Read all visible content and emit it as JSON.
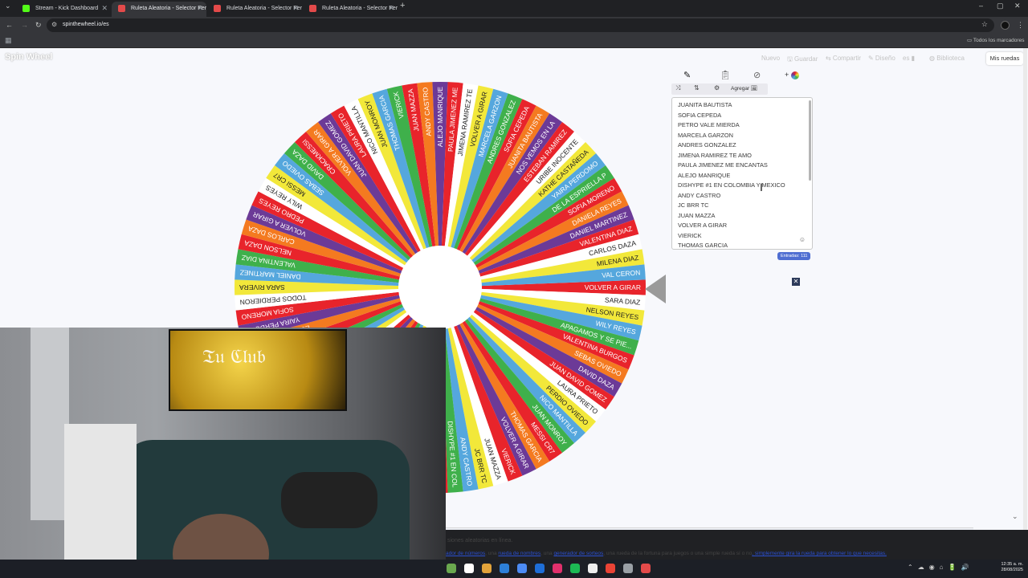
{
  "browser": {
    "tabs": [
      {
        "title": "Stream - Kick Dashboard",
        "favicon_color": "#53fc18",
        "active": false
      },
      {
        "title": "Ruleta Aleatoria - Selector Pers",
        "favicon_color": "#e34a4a",
        "active": true
      },
      {
        "title": "Ruleta Aleatoria - Selector Pers",
        "favicon_color": "#e34a4a",
        "active": false
      },
      {
        "title": "Ruleta Aleatoria - Selector Pers",
        "favicon_color": "#e34a4a",
        "active": false
      }
    ],
    "url": "spinthewheel.io/es",
    "bookmarks_label": "Todos los marcadores"
  },
  "site": {
    "logo": "Spin Wheel",
    "nav": [
      "Nuevo",
      "Guardar",
      "Compartir",
      "Diseño",
      "es",
      "Biblioteca"
    ],
    "my_wheels": "Mis ruedas",
    "add_button": "Agregar",
    "entries_count": "Entradas: 111",
    "panel_entries": [
      "JUANITA BAUTISTA",
      "SOFIA CEPEDA",
      "PETRO VALE MIERDA",
      "MARCELA GARZON",
      "ANDRES GONZALEZ",
      "JIMENA RAMIREZ TE AMO",
      "PAULA JIMENEZ ME ENCANTAS",
      "ALEJO MANRIQUE",
      "DISHYPE #1 EN COLOMBIA Y MEXICO",
      "ANDY CASTRO",
      "JC BRR TC",
      "JUAN MAZZA",
      "VOLVER A GIRAR",
      "VIERICK",
      "THOMAS GARCIA"
    ],
    "footer_line1": "siones aleatorias en línea.",
    "footer_line2_parts": [
      "ador de números",
      ", una ",
      "rueda de nombres",
      ", una ",
      "generador de sorteos",
      ", una rueda de la fortuna para juegos o una simple ",
      "rueda sí o no",
      ", simplemente gira la rueda para obtener lo que necesitas."
    ]
  },
  "wheel": {
    "colors": [
      "#e8242b",
      "#ffffff",
      "#f2e83a",
      "#55a7dd",
      "#3fb04b",
      "#e8242b",
      "#f47a20",
      "#6c3a97"
    ],
    "labels": [
      "VOLVER A GIRAR",
      "SARA DIAZ",
      "NELSON REYES",
      "WILY REYES",
      "APAGAMOS Y SE PIE...",
      "VALENTINA BURGOS",
      "SEBAS OVIEDO",
      "DAVID DAZA",
      "JUAN DAVID GOMEZ",
      "LAURA PRIETO",
      "PERDIO OVIEDO",
      "NICO MANTILLA",
      "JUAN MONROY",
      "MESSI CR7",
      "THOMAS GARCIA",
      "VOLVER A GIRAR",
      "VIERICK",
      "JUAN MAZZA",
      "JC BRR TC",
      "ANDY CASTRO",
      "DISHYPE #1 EN COL",
      "ALEJO MANRIQUE",
      "PAULA JIMENEZ ME",
      "JIMENA RAMIREZ TE",
      "ANDRES GONZALEZ",
      "MARCELA GARZON",
      "PETRO VALE MIERDA",
      "SOFIA CEPEDA",
      "JUAN MAZZA",
      "ANDY CASTRO",
      "ALEJO MANRIQUE",
      "PAULA JIMENEZ ME",
      "JIMENA RAMIREZ TE",
      "MARCELA GARZON",
      "PETRO VALE",
      "VOLVER A GIRAR",
      "SOFIA CEPEDA",
      "JUANITA BAUTISTA",
      "ESTEBAN RAMIREZ",
      "YAIRA PERDOMO",
      "SOFIA MORENO",
      "TODOS PERDIERON",
      "SARA RIVERA",
      "DANIEL MARTINEZ",
      "VALENTINA DIAZ",
      "NELSON DAZA",
      "CARLOS DAZA",
      "VOLVER A GIRAR",
      "PEDRO REYES",
      "WILY REYES",
      "MESSI CR7",
      "SEBAS OVIEDO",
      "DAVID DAZA",
      "CRACKMESSI",
      "VOLVER A GIRAR",
      "JUAN DAVID GOMEZ",
      "LAURA PRIETO",
      "NICO MANTILLA",
      "JUAN MONROY",
      "THOMAS GARCIA",
      "VIERICK",
      "JUAN MAZZA",
      "ANDY CASTRO",
      "ALEJO MANRIQUE",
      "PAULA JIMENEZ ME",
      "JIMENA RAMIREZ TE",
      "VOLVER A GIRAR",
      "MARCELA GARZON",
      "ANDRES GONZALEZ",
      "SOFIA CEPEDA",
      "JUANITA BAUTISTA",
      "NOS VEMOS EN LA",
      "ESTEBAN RAMIREZ",
      "URIBE INOCENTE",
      "KATHE CASTAÑEDA",
      "YAIRA PERDOMO",
      "DE LA ESPRIELLA P",
      "SOFIA MORENO",
      "DANIELA REYES",
      "DANIEL MARTINEZ",
      "VALENTINA DIAZ",
      "CARLOS DAZA",
      "MILENA DIAZ",
      "VAL CERON"
    ]
  },
  "clock": {
    "time": "12:35 a. m.",
    "date": "28/08/2025"
  }
}
